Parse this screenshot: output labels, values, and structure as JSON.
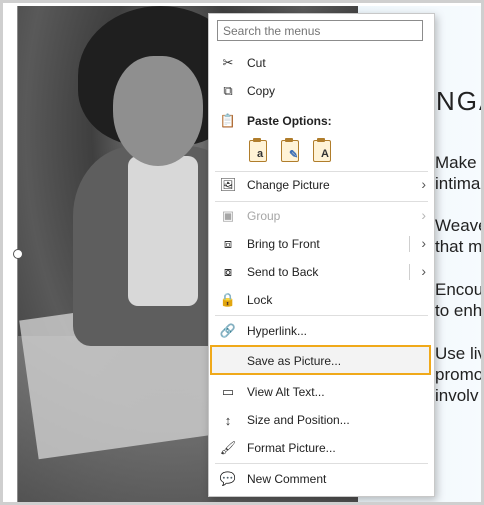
{
  "slide_panel": {
    "heading": "NGA",
    "lines": [
      "Make",
      "intima",
      "Weave",
      "that m",
      "Encou",
      "to enh",
      "Use liv",
      "promo",
      "involv"
    ]
  },
  "menu": {
    "search_placeholder": "Search the menus",
    "items": {
      "cut": "Cut",
      "copy": "Copy",
      "paste_options": "Paste Options:",
      "change_picture": "Change Picture",
      "group": "Group",
      "bring_to_front": "Bring to Front",
      "send_to_back": "Send to Back",
      "lock": "Lock",
      "hyperlink": "Hyperlink...",
      "save_as_picture": "Save as Picture...",
      "view_alt_text": "View Alt Text...",
      "size_and_position": "Size and Position...",
      "format_picture": "Format Picture...",
      "new_comment": "New Comment"
    },
    "highlight_color": "#f0a91a",
    "submenu_arrow": "›"
  },
  "icons": {
    "cut": "scissors-icon",
    "copy": "copy-icon",
    "paste": "clipboard-icon",
    "change_picture": "change-picture-icon",
    "group": "group-icon",
    "bring_to_front": "bring-front-icon",
    "send_to_back": "send-back-icon",
    "lock": "lock-icon",
    "hyperlink": "link-icon",
    "view_alt_text": "alt-text-icon",
    "size_and_position": "size-position-icon",
    "format_picture": "format-picture-icon",
    "new_comment": "comment-icon"
  }
}
